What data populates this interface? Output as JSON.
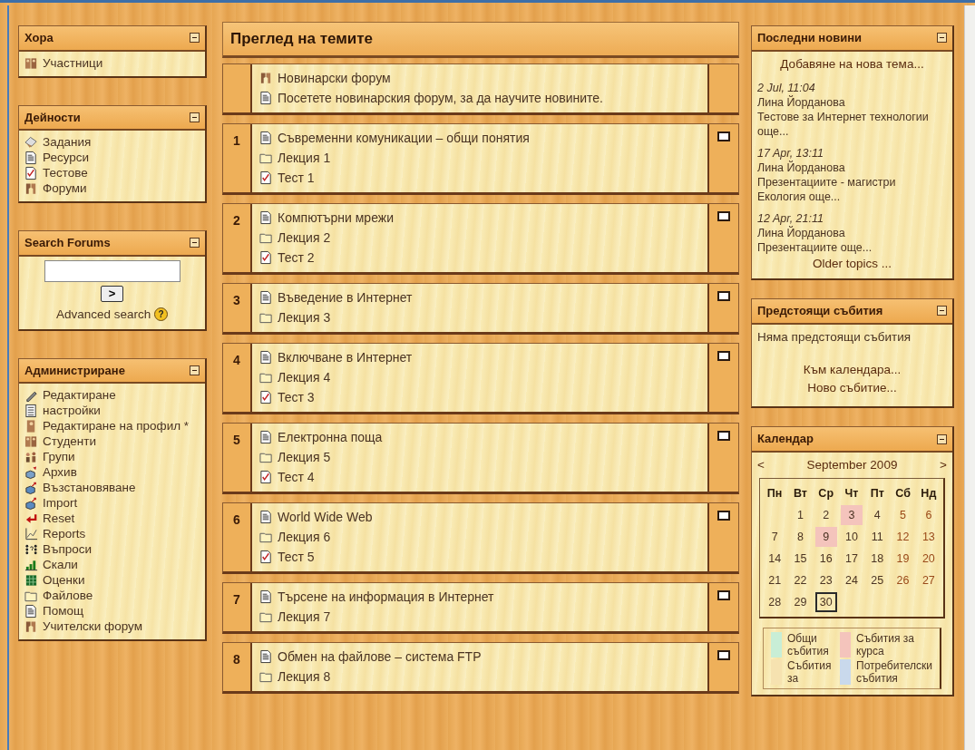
{
  "left_blocks": [
    {
      "title": "Хора",
      "kind": "links",
      "items": [
        {
          "label": "Участници",
          "kind": "people"
        }
      ]
    },
    {
      "title": "Дейности",
      "kind": "links",
      "items": [
        {
          "label": "Задания",
          "kind": "assignment"
        },
        {
          "label": "Ресурси",
          "kind": "document"
        },
        {
          "label": "Тестове",
          "kind": "quiz"
        },
        {
          "label": "Форуми",
          "kind": "forum"
        }
      ]
    },
    {
      "title": "Search Forums",
      "kind": "search",
      "button": ">",
      "link": "Advanced search",
      "help_mark": "?"
    },
    {
      "title": "Администриране",
      "kind": "links",
      "items": [
        {
          "label": "Редактиране",
          "kind": "edit"
        },
        {
          "label": "настройки",
          "kind": "settings"
        },
        {
          "label": "Редактиране на профил *",
          "kind": "profile"
        },
        {
          "label": "Студенти",
          "kind": "people"
        },
        {
          "label": "Групи",
          "kind": "groups"
        },
        {
          "label": "Архив",
          "kind": "backup"
        },
        {
          "label": "Възстановяване",
          "kind": "restore"
        },
        {
          "label": "Import",
          "kind": "restore"
        },
        {
          "label": "Reset",
          "kind": "reset"
        },
        {
          "label": "Reports",
          "kind": "reports"
        },
        {
          "label": "Въпроси",
          "kind": "questions"
        },
        {
          "label": "Скали",
          "kind": "scales"
        },
        {
          "label": "Оценки",
          "kind": "grades"
        },
        {
          "label": "Файлове",
          "kind": "folder"
        },
        {
          "label": "Помощ",
          "kind": "document"
        },
        {
          "label": "Учителски форум",
          "kind": "forum"
        }
      ]
    }
  ],
  "main": {
    "title": "Преглед на темите",
    "sections": [
      {
        "items": [
          {
            "label": "Новинарски форум",
            "kind": "forum"
          },
          {
            "label": "Посетете новинарския форум, за да научите новините.",
            "kind": "document"
          }
        ]
      },
      {
        "number": "1",
        "items": [
          {
            "label": "Съвременни комуникации – общи понятия",
            "kind": "document"
          },
          {
            "label": "Лекция 1",
            "kind": "folder"
          },
          {
            "label": "Тест 1",
            "kind": "quiz"
          }
        ]
      },
      {
        "number": "2",
        "items": [
          {
            "label": "Компютърни мрежи",
            "kind": "document"
          },
          {
            "label": "Лекция 2",
            "kind": "folder"
          },
          {
            "label": "Тест 2",
            "kind": "quiz"
          }
        ]
      },
      {
        "number": "3",
        "items": [
          {
            "label": "Въведение в Интернет",
            "kind": "document"
          },
          {
            "label": "Лекция 3",
            "kind": "folder"
          }
        ]
      },
      {
        "number": "4",
        "items": [
          {
            "label": "Включване в Интернет",
            "kind": "document"
          },
          {
            "label": "Лекция 4",
            "kind": "folder"
          },
          {
            "label": "Тест 3",
            "kind": "quiz"
          }
        ]
      },
      {
        "number": "5",
        "items": [
          {
            "label": "Електронна поща",
            "kind": "document"
          },
          {
            "label": "Лекция 5",
            "kind": "folder"
          },
          {
            "label": "Тест 4",
            "kind": "quiz"
          }
        ]
      },
      {
        "number": "6",
        "items": [
          {
            "label": "World Wide Web",
            "kind": "document"
          },
          {
            "label": "Лекция 6",
            "kind": "folder"
          },
          {
            "label": "Тест 5",
            "kind": "quiz"
          }
        ]
      },
      {
        "number": "7",
        "items": [
          {
            "label": "Търсене на информация в Интернет",
            "kind": "document"
          },
          {
            "label": "Лекция 7",
            "kind": "folder"
          }
        ]
      },
      {
        "number": "8",
        "items": [
          {
            "label": "Обмен на файлове – система FTP",
            "kind": "document"
          },
          {
            "label": "Лекция 8",
            "kind": "folder"
          }
        ]
      }
    ]
  },
  "news": {
    "title": "Последни новини",
    "add_link": "Добавяне на нова тема...",
    "posts": [
      {
        "date": "2 Jul, 11:04",
        "author": "Лина Йорданова",
        "text": "Тестове за Интернет технологии още..."
      },
      {
        "date": "17 Apr, 13:11",
        "author": "Лина Йорданова",
        "text": "Презентациите - магистри Екология още..."
      },
      {
        "date": "12 Apr, 21:11",
        "author": "Лина Йорданова",
        "text": "Презентациите още..."
      }
    ],
    "older_link": "Older topics ..."
  },
  "upcoming": {
    "title": "Предстоящи събития",
    "text": "Няма предстоящи събития",
    "links": [
      "Към календара...",
      "Ново събитие..."
    ]
  },
  "calendar": {
    "title": "Календар",
    "prev": "<",
    "month": "September 2009",
    "next": ">",
    "weekdays": [
      "Пн",
      "Вт",
      "Ср",
      "Чт",
      "Пт",
      "Сб",
      "Нд"
    ],
    "weeks": [
      [
        {
          "day": "1",
          "selected": false
        },
        {
          "day": "2",
          "selected": false
        },
        {
          "day": "3",
          "selected": false,
          "color": "#f4c4bc"
        },
        {
          "day": "4",
          "selected": false
        },
        {
          "day": "5",
          "selected": false
        },
        {
          "day": "6",
          "selected": false
        }
      ],
      [
        {
          "day": "7",
          "selected": false
        },
        {
          "day": "8",
          "selected": false
        },
        {
          "day": "9",
          "selected": false,
          "color": "#f4c4bc"
        },
        {
          "day": "10",
          "selected": false
        },
        {
          "day": "11",
          "selected": false
        },
        {
          "day": "12",
          "selected": false
        },
        {
          "day": "13",
          "selected": false
        }
      ],
      [
        {
          "day": "14",
          "selected": false
        },
        {
          "day": "15",
          "selected": false
        },
        {
          "day": "16",
          "selected": false
        },
        {
          "day": "17",
          "selected": false
        },
        {
          "day": "18",
          "selected": false
        },
        {
          "day": "19",
          "selected": false
        },
        {
          "day": "20",
          "selected": false
        }
      ],
      [
        {
          "day": "21",
          "selected": false
        },
        {
          "day": "22",
          "selected": false
        },
        {
          "day": "23",
          "selected": false
        },
        {
          "day": "24",
          "selected": false
        },
        {
          "day": "25",
          "selected": false
        },
        {
          "day": "26",
          "selected": false
        },
        {
          "day": "27",
          "selected": false
        }
      ],
      [
        {
          "day": "28",
          "selected": false
        },
        {
          "day": "29",
          "selected": false
        },
        {
          "day": "30",
          "selected": true
        }
      ]
    ],
    "legend": [
      {
        "label": "Общи събития",
        "color": "#c8eed6"
      },
      {
        "label": "Събития за курса",
        "color": "#f4c4bc"
      },
      {
        "label": "Събития за",
        "color": "#f6e2b0"
      },
      {
        "label": "Потребителски събития",
        "color": "#c9d9ec"
      }
    ]
  }
}
